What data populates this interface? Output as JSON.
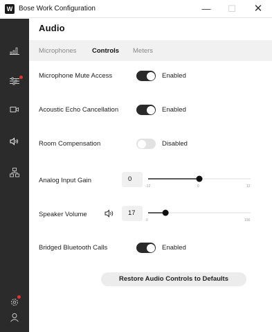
{
  "window": {
    "title": "Bose Work Configuration",
    "app_icon_glyph": "W",
    "minimize_glyph": "—",
    "maximize_glyph": "☐",
    "close_glyph": "✕"
  },
  "sidebar": {
    "items": [
      {
        "icon": "signal-bars-icon",
        "has_alert": false
      },
      {
        "icon": "sliders-icon",
        "has_alert": true
      },
      {
        "icon": "camera-icon",
        "has_alert": false
      },
      {
        "icon": "audio-icon",
        "has_alert": false,
        "active": true
      },
      {
        "icon": "network-icon",
        "has_alert": false
      },
      {
        "icon": "gear-icon",
        "has_alert": true
      },
      {
        "icon": "user-icon",
        "has_alert": false
      }
    ]
  },
  "page": {
    "title": "Audio",
    "tabs": [
      {
        "label": "Microphones",
        "active": false
      },
      {
        "label": "Controls",
        "active": true
      },
      {
        "label": "Meters",
        "active": false
      }
    ]
  },
  "controls": {
    "mic_mute": {
      "label": "Microphone Mute Access",
      "state": true,
      "state_text": "Enabled"
    },
    "aec": {
      "label": "Acoustic Echo Cancellation",
      "state": true,
      "state_text": "Enabled"
    },
    "room_comp": {
      "label": "Room Compensation",
      "state": false,
      "state_text": "Disabled"
    },
    "analog_gain": {
      "label": "Analog Input Gain",
      "value": "0",
      "min_label": "-12",
      "mid_label": "0",
      "max_label": "12",
      "min": -12,
      "max": 12,
      "current": 0
    },
    "speaker_volume": {
      "label": "Speaker Volume",
      "value": "17",
      "min_label": "0",
      "max_label": "100",
      "min": 0,
      "max": 100,
      "current": 17,
      "icon": "speaker-icon"
    },
    "bluetooth": {
      "label": "Bridged Bluetooth Calls",
      "state": true,
      "state_text": "Enabled"
    },
    "restore_label": "Restore Audio Controls to Defaults"
  },
  "colors": {
    "sidebar_bg": "#2b2b2b",
    "toggle_on": "#2a2a2a",
    "toggle_off": "#e2e2e2",
    "alert_dot": "#e03333",
    "slider_track": "#222222"
  }
}
